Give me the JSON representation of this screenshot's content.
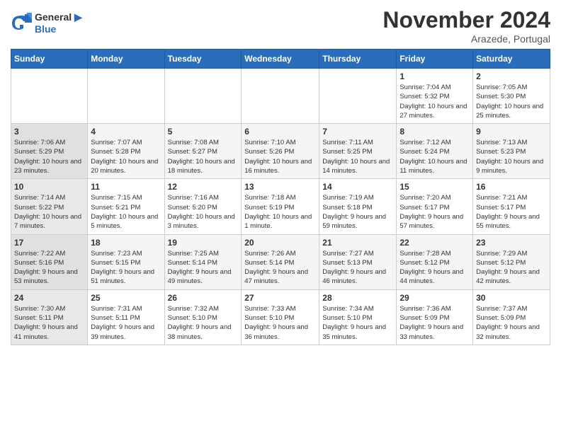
{
  "header": {
    "logo_general": "General",
    "logo_blue": "Blue",
    "month": "November 2024",
    "location": "Arazede, Portugal"
  },
  "days_of_week": [
    "Sunday",
    "Monday",
    "Tuesday",
    "Wednesday",
    "Thursday",
    "Friday",
    "Saturday"
  ],
  "weeks": [
    [
      {
        "day": "",
        "info": ""
      },
      {
        "day": "",
        "info": ""
      },
      {
        "day": "",
        "info": ""
      },
      {
        "day": "",
        "info": ""
      },
      {
        "day": "",
        "info": ""
      },
      {
        "day": "1",
        "info": "Sunrise: 7:04 AM\nSunset: 5:32 PM\nDaylight: 10 hours and 27 minutes."
      },
      {
        "day": "2",
        "info": "Sunrise: 7:05 AM\nSunset: 5:30 PM\nDaylight: 10 hours and 25 minutes."
      }
    ],
    [
      {
        "day": "3",
        "info": "Sunrise: 7:06 AM\nSunset: 5:29 PM\nDaylight: 10 hours and 23 minutes."
      },
      {
        "day": "4",
        "info": "Sunrise: 7:07 AM\nSunset: 5:28 PM\nDaylight: 10 hours and 20 minutes."
      },
      {
        "day": "5",
        "info": "Sunrise: 7:08 AM\nSunset: 5:27 PM\nDaylight: 10 hours and 18 minutes."
      },
      {
        "day": "6",
        "info": "Sunrise: 7:10 AM\nSunset: 5:26 PM\nDaylight: 10 hours and 16 minutes."
      },
      {
        "day": "7",
        "info": "Sunrise: 7:11 AM\nSunset: 5:25 PM\nDaylight: 10 hours and 14 minutes."
      },
      {
        "day": "8",
        "info": "Sunrise: 7:12 AM\nSunset: 5:24 PM\nDaylight: 10 hours and 11 minutes."
      },
      {
        "day": "9",
        "info": "Sunrise: 7:13 AM\nSunset: 5:23 PM\nDaylight: 10 hours and 9 minutes."
      }
    ],
    [
      {
        "day": "10",
        "info": "Sunrise: 7:14 AM\nSunset: 5:22 PM\nDaylight: 10 hours and 7 minutes."
      },
      {
        "day": "11",
        "info": "Sunrise: 7:15 AM\nSunset: 5:21 PM\nDaylight: 10 hours and 5 minutes."
      },
      {
        "day": "12",
        "info": "Sunrise: 7:16 AM\nSunset: 5:20 PM\nDaylight: 10 hours and 3 minutes."
      },
      {
        "day": "13",
        "info": "Sunrise: 7:18 AM\nSunset: 5:19 PM\nDaylight: 10 hours and 1 minute."
      },
      {
        "day": "14",
        "info": "Sunrise: 7:19 AM\nSunset: 5:18 PM\nDaylight: 9 hours and 59 minutes."
      },
      {
        "day": "15",
        "info": "Sunrise: 7:20 AM\nSunset: 5:17 PM\nDaylight: 9 hours and 57 minutes."
      },
      {
        "day": "16",
        "info": "Sunrise: 7:21 AM\nSunset: 5:17 PM\nDaylight: 9 hours and 55 minutes."
      }
    ],
    [
      {
        "day": "17",
        "info": "Sunrise: 7:22 AM\nSunset: 5:16 PM\nDaylight: 9 hours and 53 minutes."
      },
      {
        "day": "18",
        "info": "Sunrise: 7:23 AM\nSunset: 5:15 PM\nDaylight: 9 hours and 51 minutes."
      },
      {
        "day": "19",
        "info": "Sunrise: 7:25 AM\nSunset: 5:14 PM\nDaylight: 9 hours and 49 minutes."
      },
      {
        "day": "20",
        "info": "Sunrise: 7:26 AM\nSunset: 5:14 PM\nDaylight: 9 hours and 47 minutes."
      },
      {
        "day": "21",
        "info": "Sunrise: 7:27 AM\nSunset: 5:13 PM\nDaylight: 9 hours and 46 minutes."
      },
      {
        "day": "22",
        "info": "Sunrise: 7:28 AM\nSunset: 5:12 PM\nDaylight: 9 hours and 44 minutes."
      },
      {
        "day": "23",
        "info": "Sunrise: 7:29 AM\nSunset: 5:12 PM\nDaylight: 9 hours and 42 minutes."
      }
    ],
    [
      {
        "day": "24",
        "info": "Sunrise: 7:30 AM\nSunset: 5:11 PM\nDaylight: 9 hours and 41 minutes."
      },
      {
        "day": "25",
        "info": "Sunrise: 7:31 AM\nSunset: 5:11 PM\nDaylight: 9 hours and 39 minutes."
      },
      {
        "day": "26",
        "info": "Sunrise: 7:32 AM\nSunset: 5:10 PM\nDaylight: 9 hours and 38 minutes."
      },
      {
        "day": "27",
        "info": "Sunrise: 7:33 AM\nSunset: 5:10 PM\nDaylight: 9 hours and 36 minutes."
      },
      {
        "day": "28",
        "info": "Sunrise: 7:34 AM\nSunset: 5:10 PM\nDaylight: 9 hours and 35 minutes."
      },
      {
        "day": "29",
        "info": "Sunrise: 7:36 AM\nSunset: 5:09 PM\nDaylight: 9 hours and 33 minutes."
      },
      {
        "day": "30",
        "info": "Sunrise: 7:37 AM\nSunset: 5:09 PM\nDaylight: 9 hours and 32 minutes."
      }
    ]
  ]
}
